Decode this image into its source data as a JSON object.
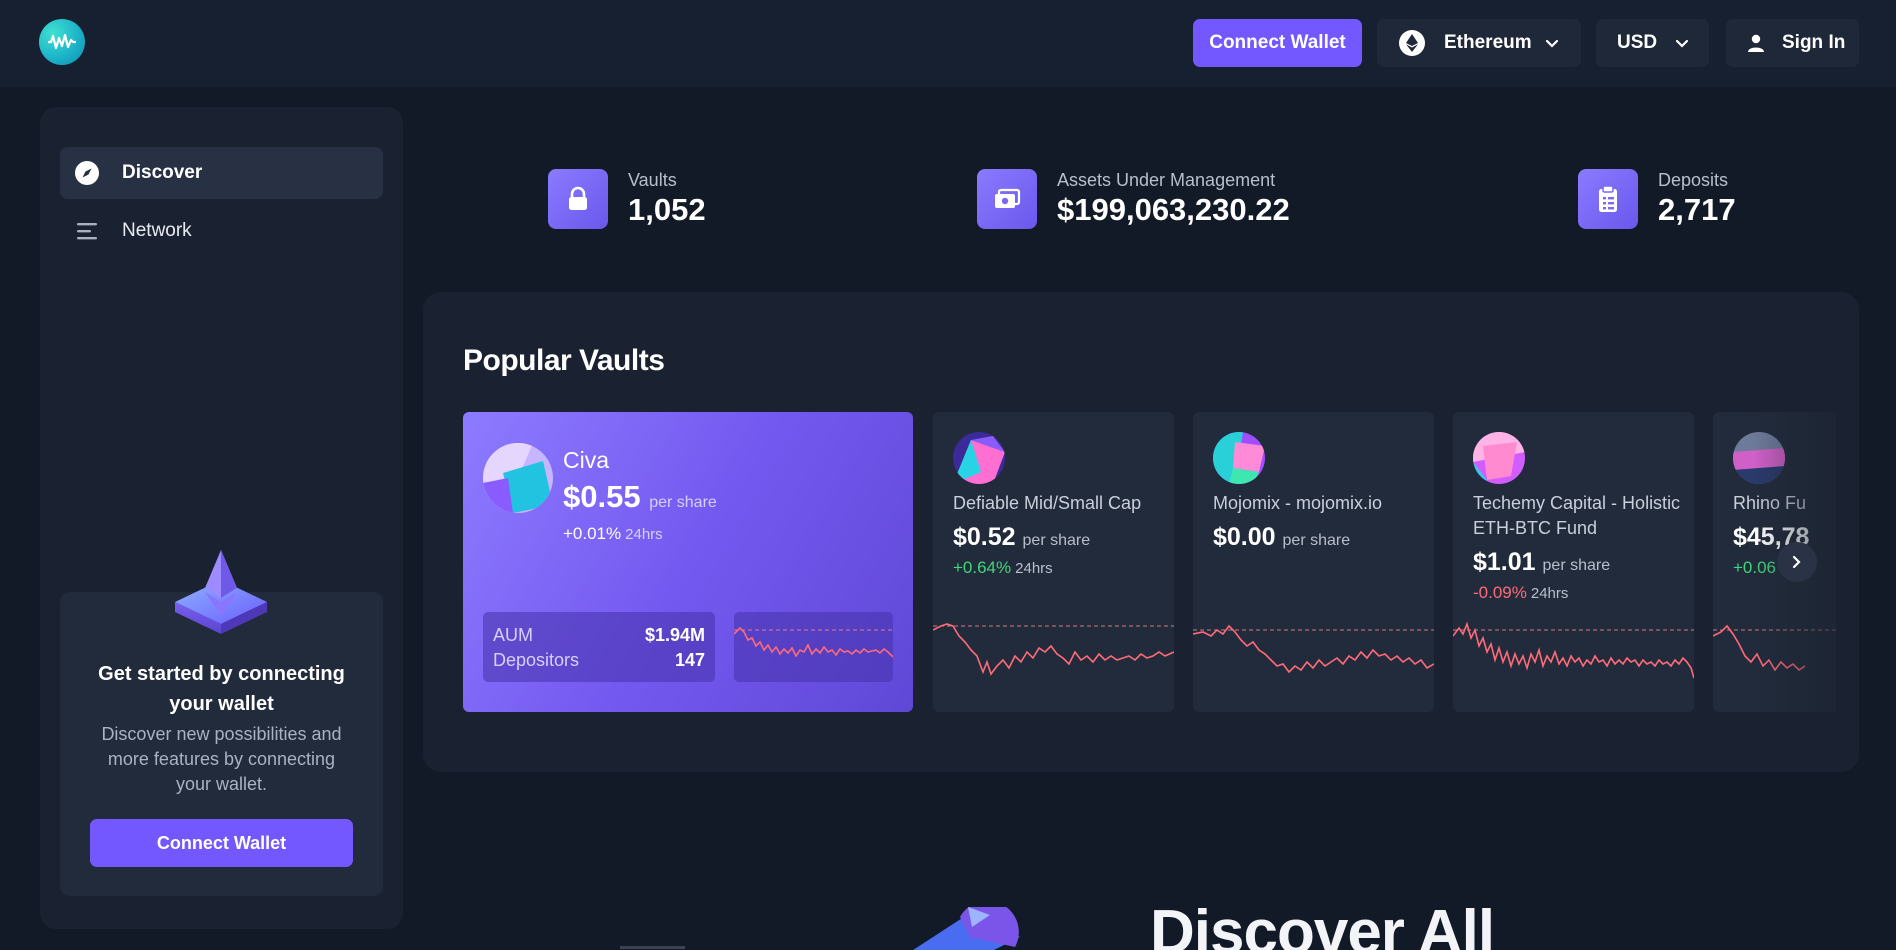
{
  "header": {
    "connect_label": "Connect Wallet",
    "network_label": "Ethereum",
    "currency_label": "USD",
    "signin_label": "Sign In"
  },
  "sidebar": {
    "items": [
      {
        "label": "Discover",
        "icon": "compass-icon",
        "active": true
      },
      {
        "label": "Network",
        "icon": "list-lines-icon",
        "active": false
      }
    ],
    "promo": {
      "title": "Get started by connecting your wallet",
      "description": "Discover new possibilities and more features by connecting your wallet.",
      "button_label": "Connect Wallet"
    }
  },
  "stats": [
    {
      "label": "Vaults",
      "value": "1,052",
      "icon": "lock-icon"
    },
    {
      "label": "Assets Under Management",
      "value": "$199,063,230.22",
      "icon": "cash-icon"
    },
    {
      "label": "Deposits",
      "value": "2,717",
      "icon": "clipboard-icon"
    }
  ],
  "popular": {
    "title": "Popular Vaults",
    "featured": {
      "name": "Civa",
      "price": "$0.55",
      "price_suffix": "per share",
      "change": "+0.01%",
      "change_period": "24hrs",
      "aum_label": "AUM",
      "aum_value": "$1.94M",
      "depositors_label": "Depositors",
      "depositors_value": "147"
    },
    "cards": [
      {
        "name": "Defiable Mid/Small Cap",
        "price": "$0.52",
        "price_suffix": "per share",
        "change": "+0.64%",
        "change_period": "24hrs",
        "direction": "up"
      },
      {
        "name": "Mojomix - mojomix.io",
        "price": "$0.00",
        "price_suffix": "per share",
        "change": "",
        "change_period": "",
        "direction": "none"
      },
      {
        "name": "Techemy Capital - Holistic ETH-BTC Fund",
        "price": "$1.01",
        "price_suffix": "per share",
        "change": "-0.09%",
        "change_period": "24hrs",
        "direction": "down"
      },
      {
        "name": "Rhino Fu",
        "price": "$45,78",
        "price_suffix": "",
        "change": "+0.06",
        "change_period": "",
        "direction": "up"
      }
    ]
  },
  "discover": {
    "title": "Discover All"
  },
  "colors": {
    "accent": "#7357ff",
    "background": "#131a27",
    "panel": "#1a2231",
    "card": "#222b3b",
    "up": "#3fd67b",
    "down": "#ff6b78"
  }
}
